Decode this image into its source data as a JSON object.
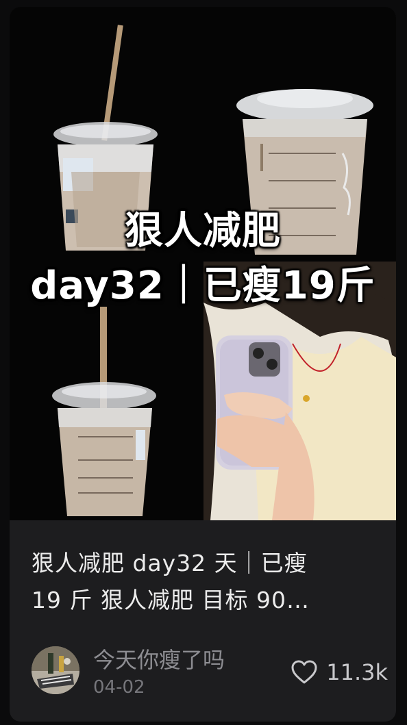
{
  "cover": {
    "overlay_line1": "狠人减肥",
    "overlay_line2": "day32｜已瘦19斤"
  },
  "post": {
    "title_line1": "狠人减肥 day32 天｜已瘦",
    "title_line2": "19 斤 狠人减肥 目标 90…"
  },
  "author": {
    "name": "今天你瘦了吗",
    "date": "04-02"
  },
  "likes": {
    "icon": "heart-icon",
    "count": "11.3k"
  },
  "colors": {
    "page_bg": "#0b0b0c",
    "card_bg": "#1d1d1f",
    "title_text": "#ececec",
    "meta_text": "#8d8d92"
  }
}
